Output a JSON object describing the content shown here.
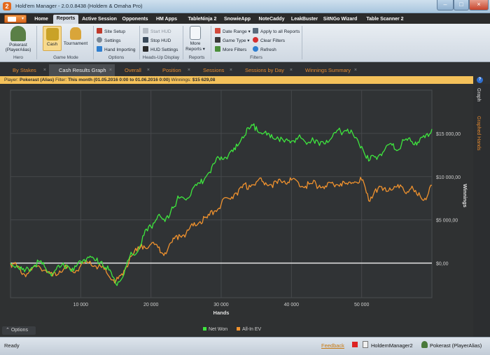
{
  "window": {
    "title": "Hold'em Manager - 2.0.0.8438 (Holdem & Omaha Pro)"
  },
  "tabs": [
    {
      "label": "Home"
    },
    {
      "label": "Reports",
      "active": true
    },
    {
      "label": "Active Session"
    },
    {
      "label": "Opponents"
    },
    {
      "label": "HM Apps"
    },
    {
      "label": "TableNinja 2"
    },
    {
      "label": "SnowieApp"
    },
    {
      "label": "NoteCaddy"
    },
    {
      "label": "LeakBuster"
    },
    {
      "label": "SitNGo Wizard"
    },
    {
      "label": "Table Scanner 2"
    }
  ],
  "ribbon": {
    "hero": {
      "name_line1": "Pokerast",
      "name_line2": "(PlayerAlias)",
      "group": "Hero"
    },
    "game_mode": {
      "cash": "Cash",
      "tournament": "Tournament",
      "group": "Game Mode"
    },
    "options": {
      "site_setup": "Site Setup",
      "settings": "Settings",
      "hand_importing": "Hand Importing",
      "group": "Options"
    },
    "hud": {
      "start": "Start HUD",
      "stop": "Stop HUD",
      "settings": "HUD Settings",
      "group": "Heads-Up Display"
    },
    "reports": {
      "more_line1": "More",
      "more_line2": "Reports ▾",
      "group": "Reports"
    },
    "filters": {
      "date_range": "Date Range ▾",
      "game_type": "Game Type ▾",
      "more_filters": "More Filters",
      "apply_all": "Apply to all Reports",
      "clear": "Clear Filters",
      "refresh": "Refresh",
      "group": "Filters"
    }
  },
  "subtabs": [
    {
      "label": "By Stakes"
    },
    {
      "label": "Cash Results Graph",
      "active": true
    },
    {
      "label": "Overall"
    },
    {
      "label": "Position"
    },
    {
      "label": "Sessions"
    },
    {
      "label": "Sessions by Day"
    },
    {
      "label": "Winnings Summary"
    }
  ],
  "filter_bar": {
    "player_label": "Player:",
    "player": "Pokerast (Alias)",
    "filter_label": "Filter:",
    "filter": "This month (01.05.2016 0:00 to 01.06.2016 0:00)",
    "winnings_label": "Winnings:",
    "winnings": "$15 629,08"
  },
  "side_tabs": {
    "graph": "Graph",
    "graphed_hands": "Graphed Hands"
  },
  "options_label": "Options",
  "status": {
    "text": "Ready",
    "feedback": "Feedback",
    "app": "HoldemManager2",
    "player": "Pokerast (PlayerAlias)"
  },
  "colors": {
    "net_won": "#3ee63e",
    "all_in_ev": "#f0922e",
    "background": "#2f3132",
    "grid": "#45484b",
    "accent": "#e68a2e"
  },
  "chart_data": {
    "type": "line",
    "xlabel": "Hands",
    "ylabel": "Winnings",
    "xlim": [
      0,
      60000
    ],
    "ylim": [
      -4000,
      20000
    ],
    "x_ticks": [
      10000,
      20000,
      30000,
      40000,
      50000
    ],
    "x_tick_labels": [
      "10 000",
      "20 000",
      "30 000",
      "40 000",
      "50 000"
    ],
    "y_ticks": [
      0,
      5000,
      10000,
      15000
    ],
    "y_tick_labels": [
      "$0,00",
      "$5 000,00",
      "$10 000,00",
      "$15 000,00"
    ],
    "legend_position": "bottom",
    "grid": true,
    "series": [
      {
        "name": "Net Won",
        "x": [
          0,
          1000,
          2000,
          3000,
          4000,
          5000,
          6000,
          7000,
          8000,
          9000,
          10000,
          11000,
          12000,
          13000,
          14000,
          15000,
          16000,
          17000,
          18000,
          19000,
          20000,
          21000,
          22000,
          23000,
          24000,
          25000,
          26000,
          27000,
          28000,
          29000,
          30000,
          31000,
          32000,
          33000,
          34000,
          35000,
          36000,
          37000,
          38000,
          39000,
          40000,
          41000,
          42000,
          43000,
          44000,
          45000,
          46000,
          47000,
          48000,
          49000,
          50000,
          51000,
          52000,
          53000,
          54000,
          55000,
          56000,
          57000,
          58000,
          59000,
          60000
        ],
        "values": [
          0,
          -300,
          -1000,
          -500,
          200,
          -600,
          -1200,
          -500,
          -200,
          -900,
          200,
          700,
          300,
          200,
          -800,
          -2400,
          -1600,
          800,
          1200,
          3200,
          4200,
          5500,
          4800,
          6500,
          7500,
          7300,
          8700,
          9200,
          10200,
          11500,
          12300,
          12400,
          13100,
          14600,
          15500,
          15800,
          15000,
          14500,
          14600,
          14000,
          14100,
          14600,
          14000,
          14500,
          13600,
          14200,
          15000,
          15200,
          15500,
          14500,
          13500,
          11800,
          12300,
          12800,
          13800,
          13000,
          14200,
          14100,
          14000,
          14500,
          15500
        ]
      },
      {
        "name": "All-In EV",
        "x": [
          0,
          1000,
          2000,
          3000,
          4000,
          5000,
          6000,
          7000,
          8000,
          9000,
          10000,
          11000,
          12000,
          13000,
          14000,
          15000,
          16000,
          17000,
          18000,
          19000,
          20000,
          21000,
          22000,
          23000,
          24000,
          25000,
          26000,
          27000,
          28000,
          29000,
          30000,
          31000,
          32000,
          33000,
          34000,
          35000,
          36000,
          37000,
          38000,
          39000,
          40000,
          41000,
          42000,
          43000,
          44000,
          45000,
          46000,
          47000,
          48000,
          49000,
          50000,
          51000,
          52000,
          53000,
          54000,
          55000,
          56000,
          57000,
          58000,
          59000,
          60000
        ],
        "values": [
          0,
          -500,
          -1300,
          -800,
          -300,
          -800,
          -1500,
          -900,
          -600,
          -1100,
          -300,
          0,
          -300,
          -500,
          -1500,
          -2100,
          -1400,
          700,
          1400,
          2000,
          2200,
          1800,
          1200,
          2400,
          3300,
          3400,
          4300,
          4800,
          5200,
          6000,
          6800,
          7500,
          8100,
          8700,
          9000,
          9400,
          9400,
          9100,
          9200,
          9500,
          9600,
          9300,
          8900,
          9200,
          9000,
          8800,
          9100,
          9200,
          9100,
          9400,
          9600,
          7200,
          8600,
          8400,
          8700,
          8800,
          8400,
          8600,
          7800,
          7500,
          9000
        ]
      }
    ]
  }
}
